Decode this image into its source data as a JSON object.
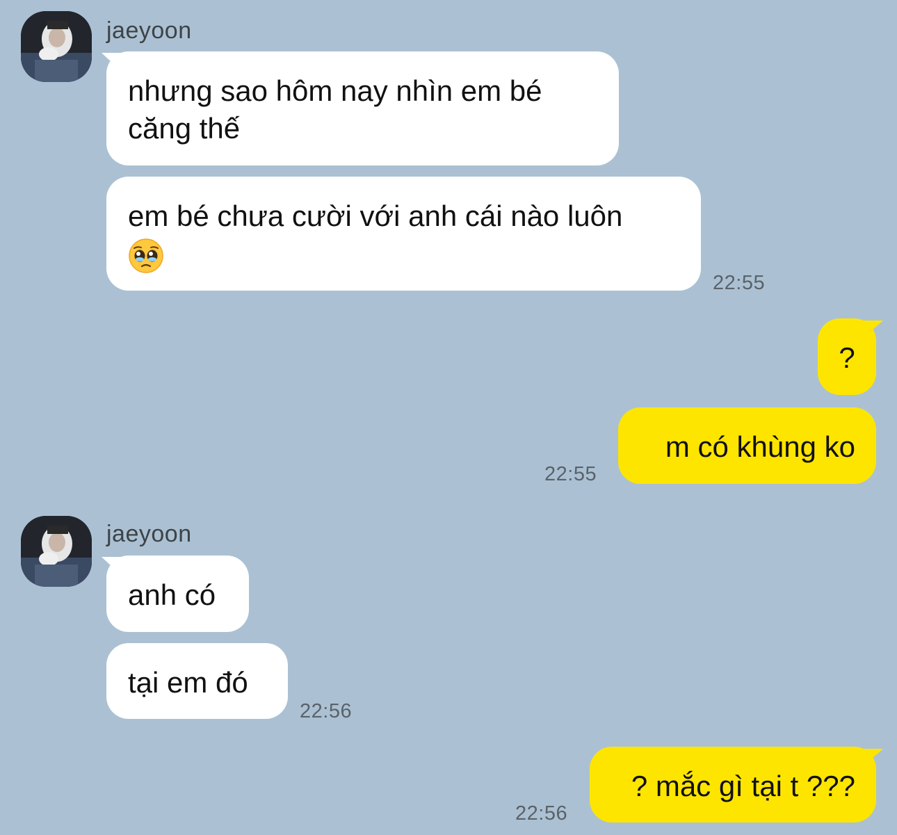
{
  "chat": {
    "groups": [
      {
        "sender": "jaeyoon",
        "avatar_icon": "avatar-photo-icon",
        "messages": [
          {
            "text": "nhưng sao hôm nay nhìn em bé\ncăng thế"
          },
          {
            "text": "em bé chưa cười với anh cái nào luôn",
            "emoji": "pleading-face-emoji"
          }
        ],
        "time": "22:55"
      },
      {
        "sender": "me",
        "messages": [
          {
            "text": "?"
          },
          {
            "text": "m có khùng ko"
          }
        ],
        "time": "22:55"
      },
      {
        "sender": "jaeyoon",
        "avatar_icon": "avatar-photo-icon",
        "messages": [
          {
            "text": "anh có"
          },
          {
            "text": "tại em đó"
          }
        ],
        "time": "22:56"
      },
      {
        "sender": "me",
        "messages": [
          {
            "text": "? mắc gì tại t ???"
          }
        ],
        "time": "22:56"
      }
    ]
  },
  "colors": {
    "background": "#abc1d3",
    "incoming_bubble": "#ffffff",
    "outgoing_bubble": "#fee500",
    "sender_name": "#3e4347",
    "timestamp": "#5a6269"
  }
}
